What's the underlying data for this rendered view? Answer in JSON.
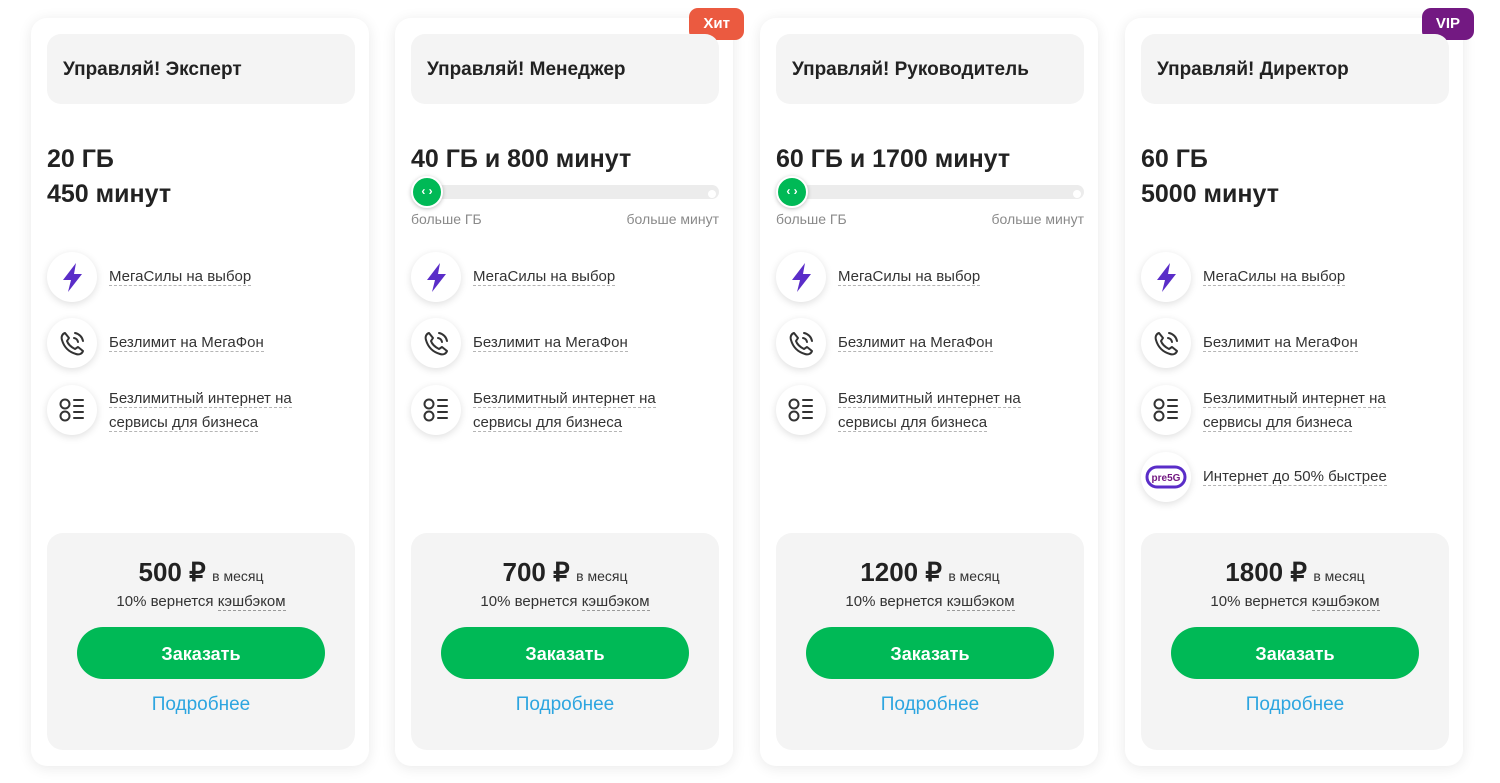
{
  "colors": {
    "accent_green": "#00b956",
    "badge_hit": "#eb5a40",
    "badge_vip": "#731982",
    "link_blue": "#2da5e0",
    "icon_purple": "#731982"
  },
  "cards": [
    {
      "title": "Управляй! Эксперт",
      "volume_line1": "20 ГБ",
      "volume_line2": "450 минут",
      "features": [
        {
          "icon": "lightning-icon",
          "text": "МегаСилы на выбор"
        },
        {
          "icon": "phone-call-icon",
          "text": "Безлимит на МегаФон"
        },
        {
          "icon": "service-list-icon",
          "text": "Безлимитный интернет на сервисы для бизнеса"
        }
      ],
      "price": "500 ₽",
      "period": "в месяц",
      "cashback_prefix": "10% вернется",
      "cashback_link": "кэшбэком",
      "order_label": "Заказать",
      "details_label": "Подробнее"
    },
    {
      "badge": "Хит",
      "title": "Управляй! Менеджер",
      "volume_line1": "40 ГБ и 800 минут",
      "slider": {
        "left_label": "больше ГБ",
        "right_label": "больше минут",
        "knob_glyph": "‹ ›",
        "position": 0
      },
      "features": [
        {
          "icon": "lightning-icon",
          "text": "МегаСилы на выбор"
        },
        {
          "icon": "phone-call-icon",
          "text": "Безлимит на МегаФон"
        },
        {
          "icon": "service-list-icon",
          "text": "Безлимитный интернет на сервисы для бизнеса"
        }
      ],
      "price": "700 ₽",
      "period": "в месяц",
      "cashback_prefix": "10% вернется",
      "cashback_link": "кэшбэком",
      "order_label": "Заказать",
      "details_label": "Подробнее"
    },
    {
      "title": "Управляй! Руководитель",
      "volume_line1": "60 ГБ и 1700 минут",
      "slider": {
        "left_label": "больше ГБ",
        "right_label": "больше минут",
        "knob_glyph": "‹ ›",
        "position": 0
      },
      "features": [
        {
          "icon": "lightning-icon",
          "text": "МегаСилы на выбор"
        },
        {
          "icon": "phone-call-icon",
          "text": "Безлимит на МегаФон"
        },
        {
          "icon": "service-list-icon",
          "text": "Безлимитный интернет на сервисы для бизнеса"
        }
      ],
      "price": "1200 ₽",
      "period": "в месяц",
      "cashback_prefix": "10% вернется",
      "cashback_link": "кэшбэком",
      "order_label": "Заказать",
      "details_label": "Подробнее"
    },
    {
      "badge": "VIP",
      "title": "Управляй! Директор",
      "volume_line1": "60 ГБ",
      "volume_line2": "5000 минут",
      "features": [
        {
          "icon": "lightning-icon",
          "text": "МегаСилы на выбор"
        },
        {
          "icon": "phone-call-icon",
          "text": "Безлимит на МегаФон"
        },
        {
          "icon": "service-list-icon",
          "text": "Безлимитный интернет на сервисы для бизнеса"
        },
        {
          "icon": "pre5g-icon",
          "icon_text": "pre5G",
          "text": "Интернет до 50% быстрее"
        }
      ],
      "price": "1800 ₽",
      "period": "в месяц",
      "cashback_prefix": "10% вернется",
      "cashback_link": "кэшбэком",
      "order_label": "Заказать",
      "details_label": "Подробнее"
    }
  ]
}
